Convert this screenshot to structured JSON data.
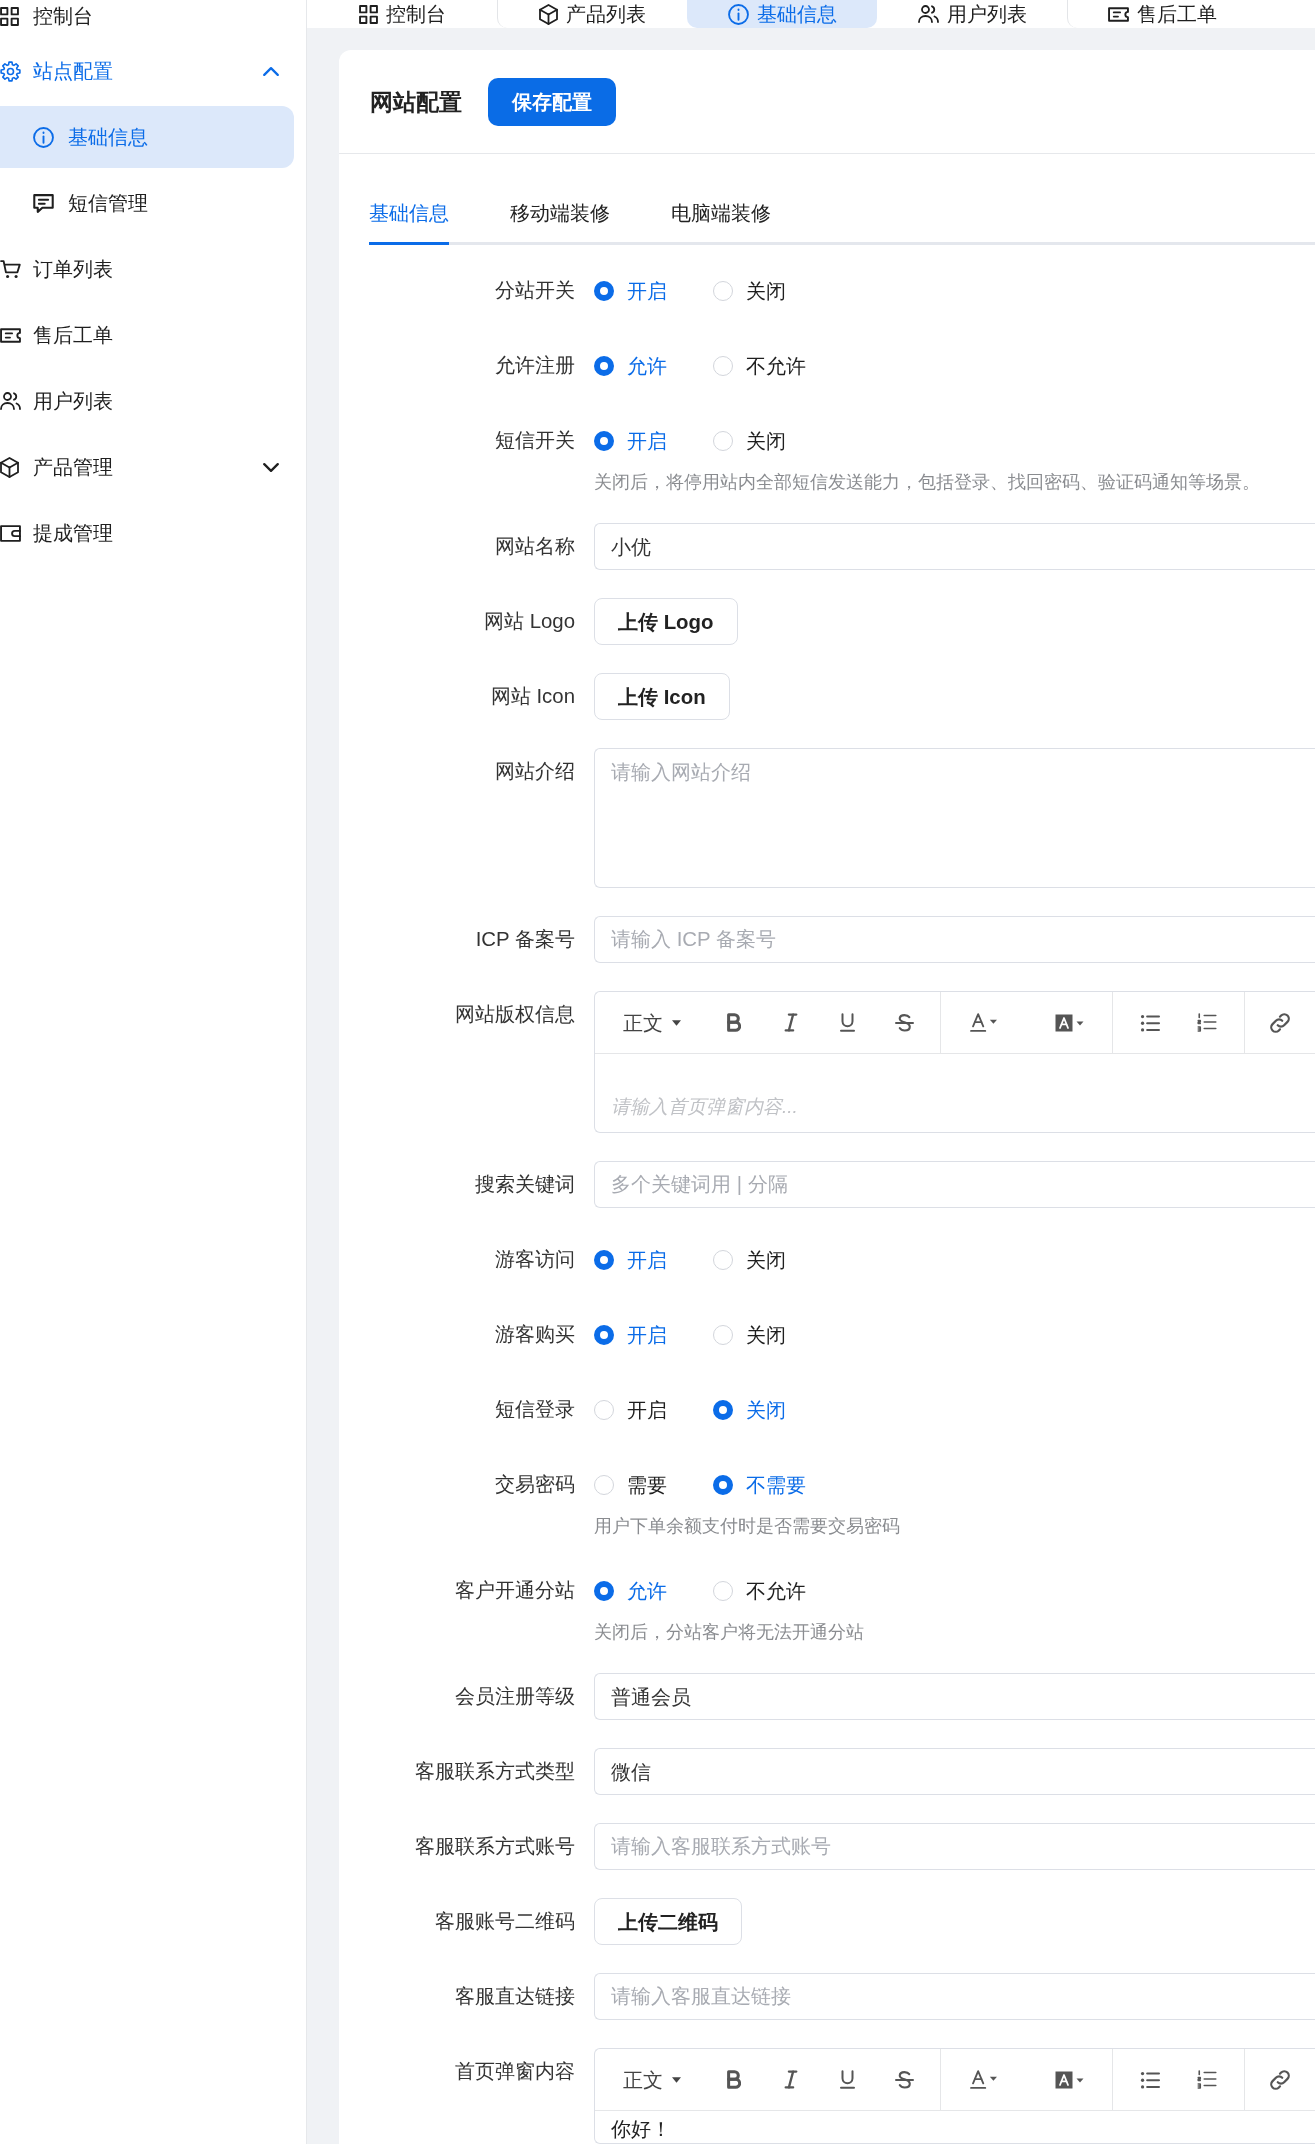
{
  "sidebar": {
    "items": [
      {
        "label": "控制台",
        "selected": false
      },
      {
        "label": "站点配置",
        "selected": false,
        "expanded": true,
        "children": [
          {
            "label": "基础信息",
            "selected": true
          },
          {
            "label": "短信管理",
            "selected": false
          }
        ]
      },
      {
        "label": "订单列表",
        "selected": false
      },
      {
        "label": "售后工单",
        "selected": false
      },
      {
        "label": "用户列表",
        "selected": false
      },
      {
        "label": "产品管理",
        "selected": false,
        "expanded": false
      },
      {
        "label": "提成管理",
        "selected": false
      }
    ]
  },
  "page_tabs": [
    {
      "label": "控制台",
      "selected": false
    },
    {
      "label": "产品列表",
      "selected": false
    },
    {
      "label": "基础信息",
      "selected": true
    },
    {
      "label": "用户列表",
      "selected": false
    },
    {
      "label": "售后工单",
      "selected": false
    }
  ],
  "card": {
    "title": "网站配置",
    "save_button": "保存配置",
    "tabs": [
      {
        "label": "基础信息",
        "selected": true
      },
      {
        "label": "移动端装修",
        "selected": false
      },
      {
        "label": "电脑端装修",
        "selected": false
      }
    ],
    "fields": [
      {
        "kind": "radio",
        "label": "分站开关",
        "options": [
          {
            "label": "开启",
            "selected": true
          },
          {
            "label": "关闭",
            "selected": false
          }
        ]
      },
      {
        "kind": "radio",
        "label": "允许注册",
        "options": [
          {
            "label": "允许",
            "selected": true
          },
          {
            "label": "不允许",
            "selected": false
          }
        ]
      },
      {
        "kind": "radio",
        "label": "短信开关",
        "options": [
          {
            "label": "开启",
            "selected": true
          },
          {
            "label": "关闭",
            "selected": false
          }
        ],
        "help": "关闭后，将停用站内全部短信发送能力，包括登录、找回密码、验证码通知等场景。"
      },
      {
        "kind": "input",
        "label": "网站名称",
        "value": "小优"
      },
      {
        "kind": "upload",
        "label": "网站 Logo",
        "button": "上传 Logo"
      },
      {
        "kind": "upload",
        "label": "网站 Icon",
        "button": "上传 Icon"
      },
      {
        "kind": "textarea",
        "label": "网站介绍",
        "placeholder": "请输入网站介绍"
      },
      {
        "kind": "input",
        "label": "ICP 备案号",
        "placeholder": "请输入 ICP 备案号"
      },
      {
        "kind": "editor",
        "label": "网站版权信息",
        "heading": "正文",
        "placeholder": "请输入首页弹窗内容..."
      },
      {
        "kind": "input",
        "label": "搜索关键词",
        "placeholder": "多个关键词用 | 分隔"
      },
      {
        "kind": "radio",
        "label": "游客访问",
        "options": [
          {
            "label": "开启",
            "selected": true
          },
          {
            "label": "关闭",
            "selected": false
          }
        ]
      },
      {
        "kind": "radio",
        "label": "游客购买",
        "options": [
          {
            "label": "开启",
            "selected": true
          },
          {
            "label": "关闭",
            "selected": false
          }
        ]
      },
      {
        "kind": "radio",
        "label": "短信登录",
        "options": [
          {
            "label": "开启",
            "selected": false
          },
          {
            "label": "关闭",
            "selected": true
          }
        ]
      },
      {
        "kind": "radio",
        "label": "交易密码",
        "options": [
          {
            "label": "需要",
            "selected": false
          },
          {
            "label": "不需要",
            "selected": true
          }
        ],
        "help": "用户下单余额支付时是否需要交易密码"
      },
      {
        "kind": "radio",
        "label": "客户开通分站",
        "options": [
          {
            "label": "允许",
            "selected": true
          },
          {
            "label": "不允许",
            "selected": false
          }
        ],
        "help": "关闭后，分站客户将无法开通分站"
      },
      {
        "kind": "input",
        "label": "会员注册等级",
        "value": "普通会员"
      },
      {
        "kind": "input",
        "label": "客服联系方式类型",
        "value": "微信"
      },
      {
        "kind": "input",
        "label": "客服联系方式账号",
        "placeholder": "请输入客服联系方式账号"
      },
      {
        "kind": "upload",
        "label": "客服账号二维码",
        "button": "上传二维码"
      },
      {
        "kind": "input",
        "label": "客服直达链接",
        "placeholder": "请输入客服直达链接"
      },
      {
        "kind": "editor",
        "label": "首页弹窗内容",
        "heading": "正文",
        "value": "你好！"
      }
    ]
  }
}
